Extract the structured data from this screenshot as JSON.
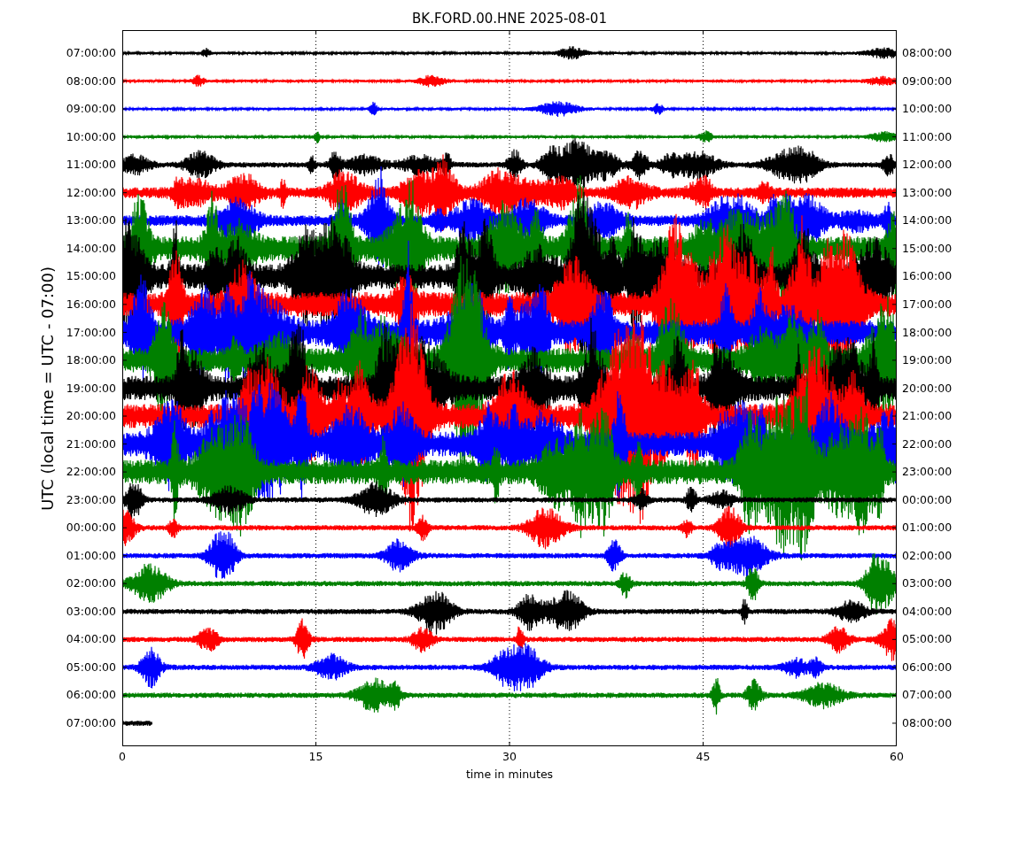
{
  "title": "BK.FORD.00.HNE 2025-08-01",
  "ylabel": "UTC (local time = UTC - 07:00)",
  "xlabel": "time in minutes",
  "xticks": [
    "0",
    "15",
    "30",
    "45",
    "60"
  ],
  "traces": [
    {
      "utc": "07:00:00",
      "local": "08:00:00",
      "color": "#000000"
    },
    {
      "utc": "08:00:00",
      "local": "09:00:00",
      "color": "#ff0000"
    },
    {
      "utc": "09:00:00",
      "local": "10:00:00",
      "color": "#0000ff"
    },
    {
      "utc": "10:00:00",
      "local": "11:00:00",
      "color": "#008000"
    },
    {
      "utc": "11:00:00",
      "local": "12:00:00",
      "color": "#000000"
    },
    {
      "utc": "12:00:00",
      "local": "13:00:00",
      "color": "#ff0000"
    },
    {
      "utc": "13:00:00",
      "local": "14:00:00",
      "color": "#0000ff"
    },
    {
      "utc": "14:00:00",
      "local": "15:00:00",
      "color": "#008000"
    },
    {
      "utc": "15:00:00",
      "local": "16:00:00",
      "color": "#000000"
    },
    {
      "utc": "16:00:00",
      "local": "17:00:00",
      "color": "#ff0000"
    },
    {
      "utc": "17:00:00",
      "local": "18:00:00",
      "color": "#0000ff"
    },
    {
      "utc": "18:00:00",
      "local": "19:00:00",
      "color": "#008000"
    },
    {
      "utc": "19:00:00",
      "local": "20:00:00",
      "color": "#000000"
    },
    {
      "utc": "20:00:00",
      "local": "21:00:00",
      "color": "#ff0000"
    },
    {
      "utc": "21:00:00",
      "local": "22:00:00",
      "color": "#0000ff"
    },
    {
      "utc": "22:00:00",
      "local": "23:00:00",
      "color": "#008000"
    },
    {
      "utc": "23:00:00",
      "local": "00:00:00",
      "color": "#000000"
    },
    {
      "utc": "00:00:00",
      "local": "01:00:00",
      "color": "#ff0000"
    },
    {
      "utc": "01:00:00",
      "local": "02:00:00",
      "color": "#0000ff"
    },
    {
      "utc": "02:00:00",
      "local": "03:00:00",
      "color": "#008000"
    },
    {
      "utc": "03:00:00",
      "local": "04:00:00",
      "color": "#000000"
    },
    {
      "utc": "04:00:00",
      "local": "05:00:00",
      "color": "#ff0000"
    },
    {
      "utc": "05:00:00",
      "local": "06:00:00",
      "color": "#0000ff"
    },
    {
      "utc": "06:00:00",
      "local": "07:00:00",
      "color": "#008000"
    },
    {
      "utc": "07:00:00",
      "local": "08:00:00",
      "color": "#000000"
    }
  ]
}
